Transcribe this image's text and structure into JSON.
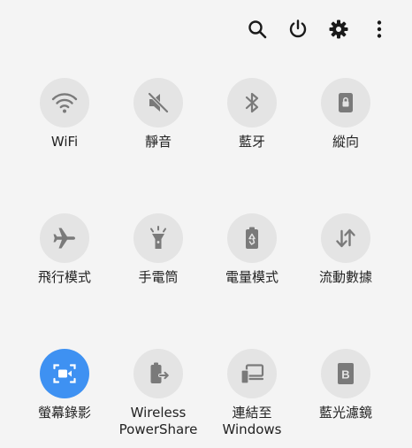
{
  "colors": {
    "background": "#f4f4f4",
    "tile_off": "#e4e4e4",
    "tile_on": "#3e91f2",
    "icon_off": "#7a7a7a",
    "icon_on": "#ffffff",
    "text": "#222222"
  },
  "topbar": [
    {
      "icon": "search-icon"
    },
    {
      "icon": "power-icon"
    },
    {
      "icon": "gear-icon"
    },
    {
      "icon": "more-vert-icon"
    }
  ],
  "tiles": [
    {
      "label": "WiFi",
      "icon": "wifi-icon",
      "active": false
    },
    {
      "label": "靜音",
      "icon": "mute-icon",
      "active": false
    },
    {
      "label": "藍牙",
      "icon": "bluetooth-icon",
      "active": false
    },
    {
      "label": "縱向",
      "icon": "portrait-lock-icon",
      "active": false
    },
    {
      "label": "飛行模式",
      "icon": "airplane-icon",
      "active": false
    },
    {
      "label": "手電筒",
      "icon": "flashlight-icon",
      "active": false
    },
    {
      "label": "電量模式",
      "icon": "battery-saver-icon",
      "active": false
    },
    {
      "label": "流動數據",
      "icon": "mobile-data-icon",
      "active": false
    },
    {
      "label": "螢幕錄影",
      "icon": "screen-recorder-icon",
      "active": true
    },
    {
      "label": "Wireless\nPowerShare",
      "icon": "wireless-powershare-icon",
      "active": false
    },
    {
      "label": "連結至\nWindows",
      "icon": "link-to-windows-icon",
      "active": false
    },
    {
      "label": "藍光濾鏡",
      "icon": "blue-light-filter-icon",
      "active": false
    }
  ]
}
